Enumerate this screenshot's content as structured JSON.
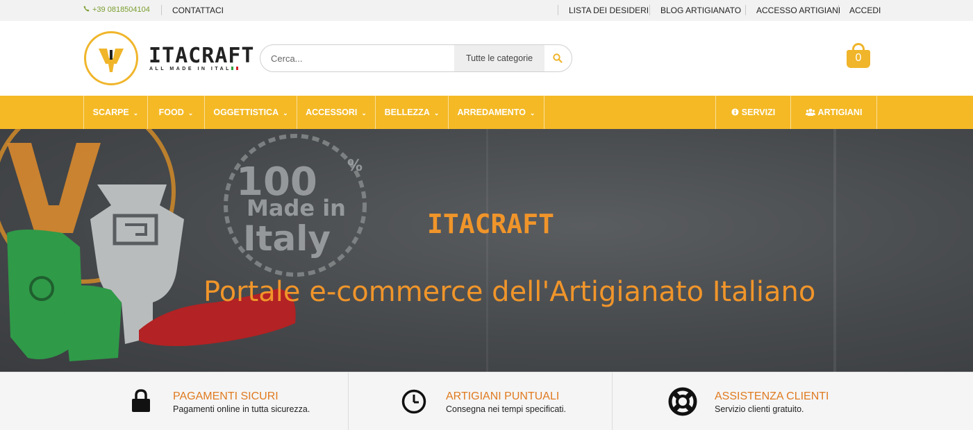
{
  "topbar": {
    "phone": "+39 0818504104",
    "contact": "CONTATTACI",
    "links": [
      "LISTA DEI DESIDERI",
      "BLOG ARTIGIANATO",
      "ACCESSO ARTIGIANI",
      "ACCEDI"
    ]
  },
  "header": {
    "logo_text": "ITACRAFT",
    "logo_tagline": "ALL MADE IN ITALY",
    "search": {
      "placeholder": "Cerca...",
      "category": "Tutte le categorie"
    },
    "cart_count": "0"
  },
  "nav": {
    "menu": [
      "SCARPE",
      "FOOD",
      "OGGETTISTICA",
      "ACCESSORI",
      "BELLEZZA",
      "ARREDAMENTO"
    ],
    "right": [
      "SERVIZI",
      "ARTIGIANI"
    ]
  },
  "hero": {
    "badge": "100% Made in Italy",
    "title": "ITACRAFT",
    "subtitle": "Portale e-commerce dell'Artigianato Italiano"
  },
  "features": [
    {
      "title": "PAGAMENTI SICURI",
      "desc": "Pagamenti online in tutta sicurezza.",
      "icon": "lock-icon"
    },
    {
      "title": "ARTIGIANI PUNTUALI",
      "desc": "Consegna nei tempi specificati.",
      "icon": "clock-icon"
    },
    {
      "title": "ASSISTENZA CLIENTI",
      "desc": "Servizio clienti gratuito.",
      "icon": "lifebuoy-icon"
    }
  ],
  "colors": {
    "accent": "#f4b925",
    "orange": "#f0952a",
    "feature_title": "#e07a1f",
    "phone": "#7a9e2f"
  }
}
